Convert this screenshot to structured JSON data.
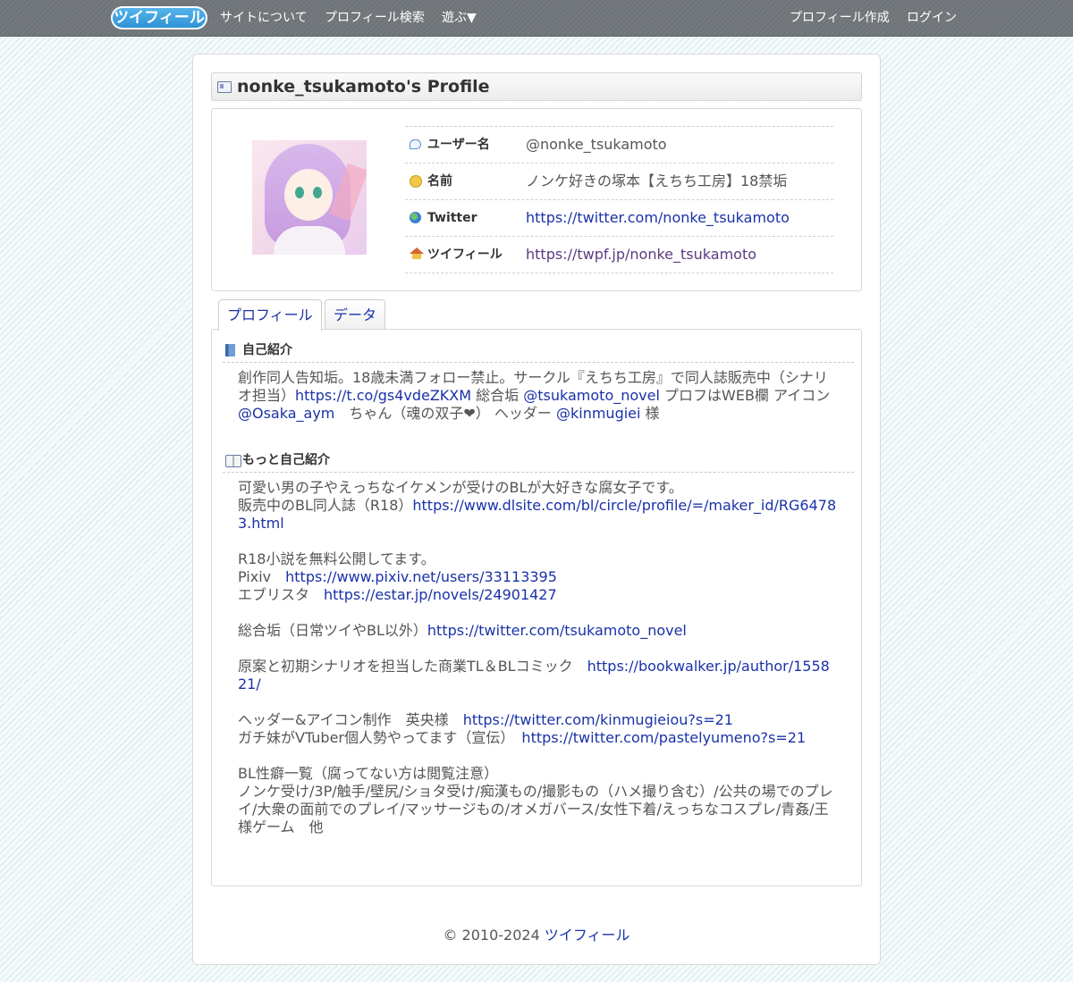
{
  "nav": {
    "logo": "ツイフィール",
    "about": "サイトについて",
    "search": "プロフィール検索",
    "play": "遊ぶ▼",
    "create": "プロフィール作成",
    "login": "ログイン"
  },
  "profile": {
    "title": "nonke_tsukamoto's Profile",
    "rows": [
      {
        "label": "ユーザー名",
        "value": "@nonke_tsukamoto",
        "icon": "speech-bubble-icon"
      },
      {
        "label": "名前",
        "value": "ノンケ好きの塚本【えちち工房】18禁垢",
        "icon": "smile-icon"
      },
      {
        "label": "Twitter",
        "value": "https://twitter.com/nonke_tsukamoto",
        "icon": "globe-icon"
      },
      {
        "label": "ツイフィール",
        "value": "https://twpf.jp/nonke_tsukamoto",
        "icon": "home-icon"
      }
    ]
  },
  "tabs": {
    "profile": "プロフィール",
    "data": "データ"
  },
  "intro": {
    "heading": "自己紹介",
    "t1": "創作同人告知垢。18歳未満フォロー禁止。サークル『えちち工房』で󠄀同人誌販売中（シナリオ担当）",
    "l1": "https://t.co/gs4vdeZKXM",
    "t2": " 総合垢 ",
    "l2": "@tsukamoto_novel",
    "t3": " プロフはWEB欄 アイコン ",
    "l3": "@Osaka_aym",
    "t4": "　ちゃん（魂の双子❤︎） ヘッダー ",
    "l4": "@kinmugiei",
    "t5": " 様"
  },
  "more": {
    "heading": "もっと自己紹介",
    "p1": "可愛い男の子やえっちなイケメンが受けのBLが大好きな腐女子です。",
    "p2": "販売中のBL同人誌（R18）",
    "l2": "https://www.dlsite.com/bl/circle/profile/=/maker_id/RG64783.html",
    "p3": "R18小説を無料公開してます。",
    "p4": "Pixiv　",
    "l4": "https://www.pixiv.net/users/33113395",
    "p5": "エブリスタ　",
    "l5": "https://estar.jp/novels/24901427",
    "p6": "総合垢（日常ツイやBL以外）",
    "l6": "https://twitter.com/tsukamoto_novel",
    "p7": "原案と初期シナリオを担当した商業TL＆BLコミック　",
    "l7": "https://bookwalker.jp/author/155821/",
    "p8": "ヘッダー&アイコン制作　英央様　",
    "l8": "https://twitter.com/kinmugieiou?s=21",
    "p9": "ガチ妹がVTuber個人勢やってます（宣伝）　",
    "l9": "https://twitter.com/pastelyumeno?s=21",
    "p10": "BL性癖一覧（腐ってない方は閲覧注意）",
    "p11": "ノンケ受け/3P/触手/壁尻/ショタ受け/痴漢もの/撮影もの（ハメ撮り含む）/公共の場でのプレイ/大衆の面前でのプレイ/マッサージもの/オメガバース/女性下着/えっちなコスプレ/青姦/王様ゲーム　他"
  },
  "footer": {
    "copy": "© 2010-2024 ",
    "link": "ツイフィール"
  }
}
